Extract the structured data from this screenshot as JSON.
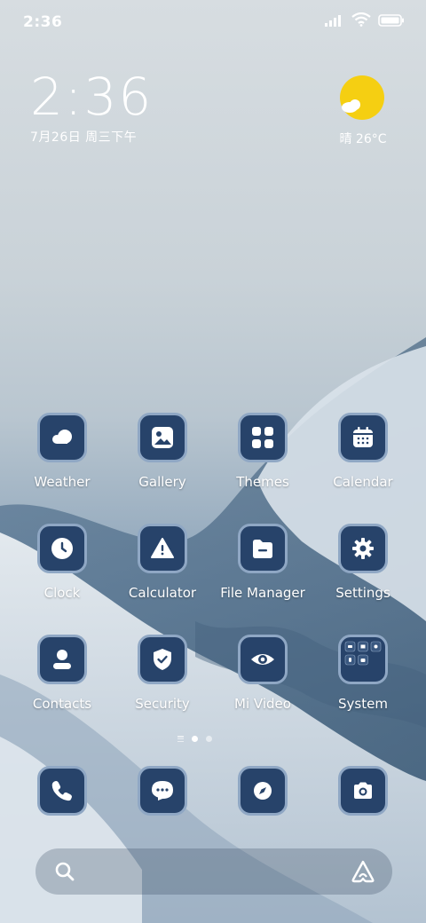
{
  "status_bar": {
    "time": "2:36"
  },
  "clock_widget": {
    "time": "2:36",
    "date": "7月26日 周三下午"
  },
  "weather_widget": {
    "text": "晴 26°C"
  },
  "apps": [
    {
      "label": "Weather",
      "icon": "weather-icon"
    },
    {
      "label": "Gallery",
      "icon": "gallery-icon"
    },
    {
      "label": "Themes",
      "icon": "themes-icon"
    },
    {
      "label": "Calendar",
      "icon": "calendar-icon"
    },
    {
      "label": "Clock",
      "icon": "clock-icon"
    },
    {
      "label": "Calculator",
      "icon": "calculator-icon"
    },
    {
      "label": "File Manager",
      "icon": "file-manager-icon"
    },
    {
      "label": "Settings",
      "icon": "settings-icon"
    },
    {
      "label": "Contacts",
      "icon": "contacts-icon"
    },
    {
      "label": "Security",
      "icon": "security-icon"
    },
    {
      "label": "Mi Video",
      "icon": "mi-video-icon"
    },
    {
      "label": "System",
      "icon": "system-folder-icon"
    }
  ],
  "dock": [
    {
      "icon": "phone-icon"
    },
    {
      "icon": "messages-icon"
    },
    {
      "icon": "browser-compass-icon"
    },
    {
      "icon": "camera-icon"
    }
  ],
  "page_indicator": {
    "current": 1,
    "total": 2
  },
  "colors": {
    "tile": "#27436a",
    "tile_border": "#8fa7c4",
    "sun": "#f5cf12"
  }
}
